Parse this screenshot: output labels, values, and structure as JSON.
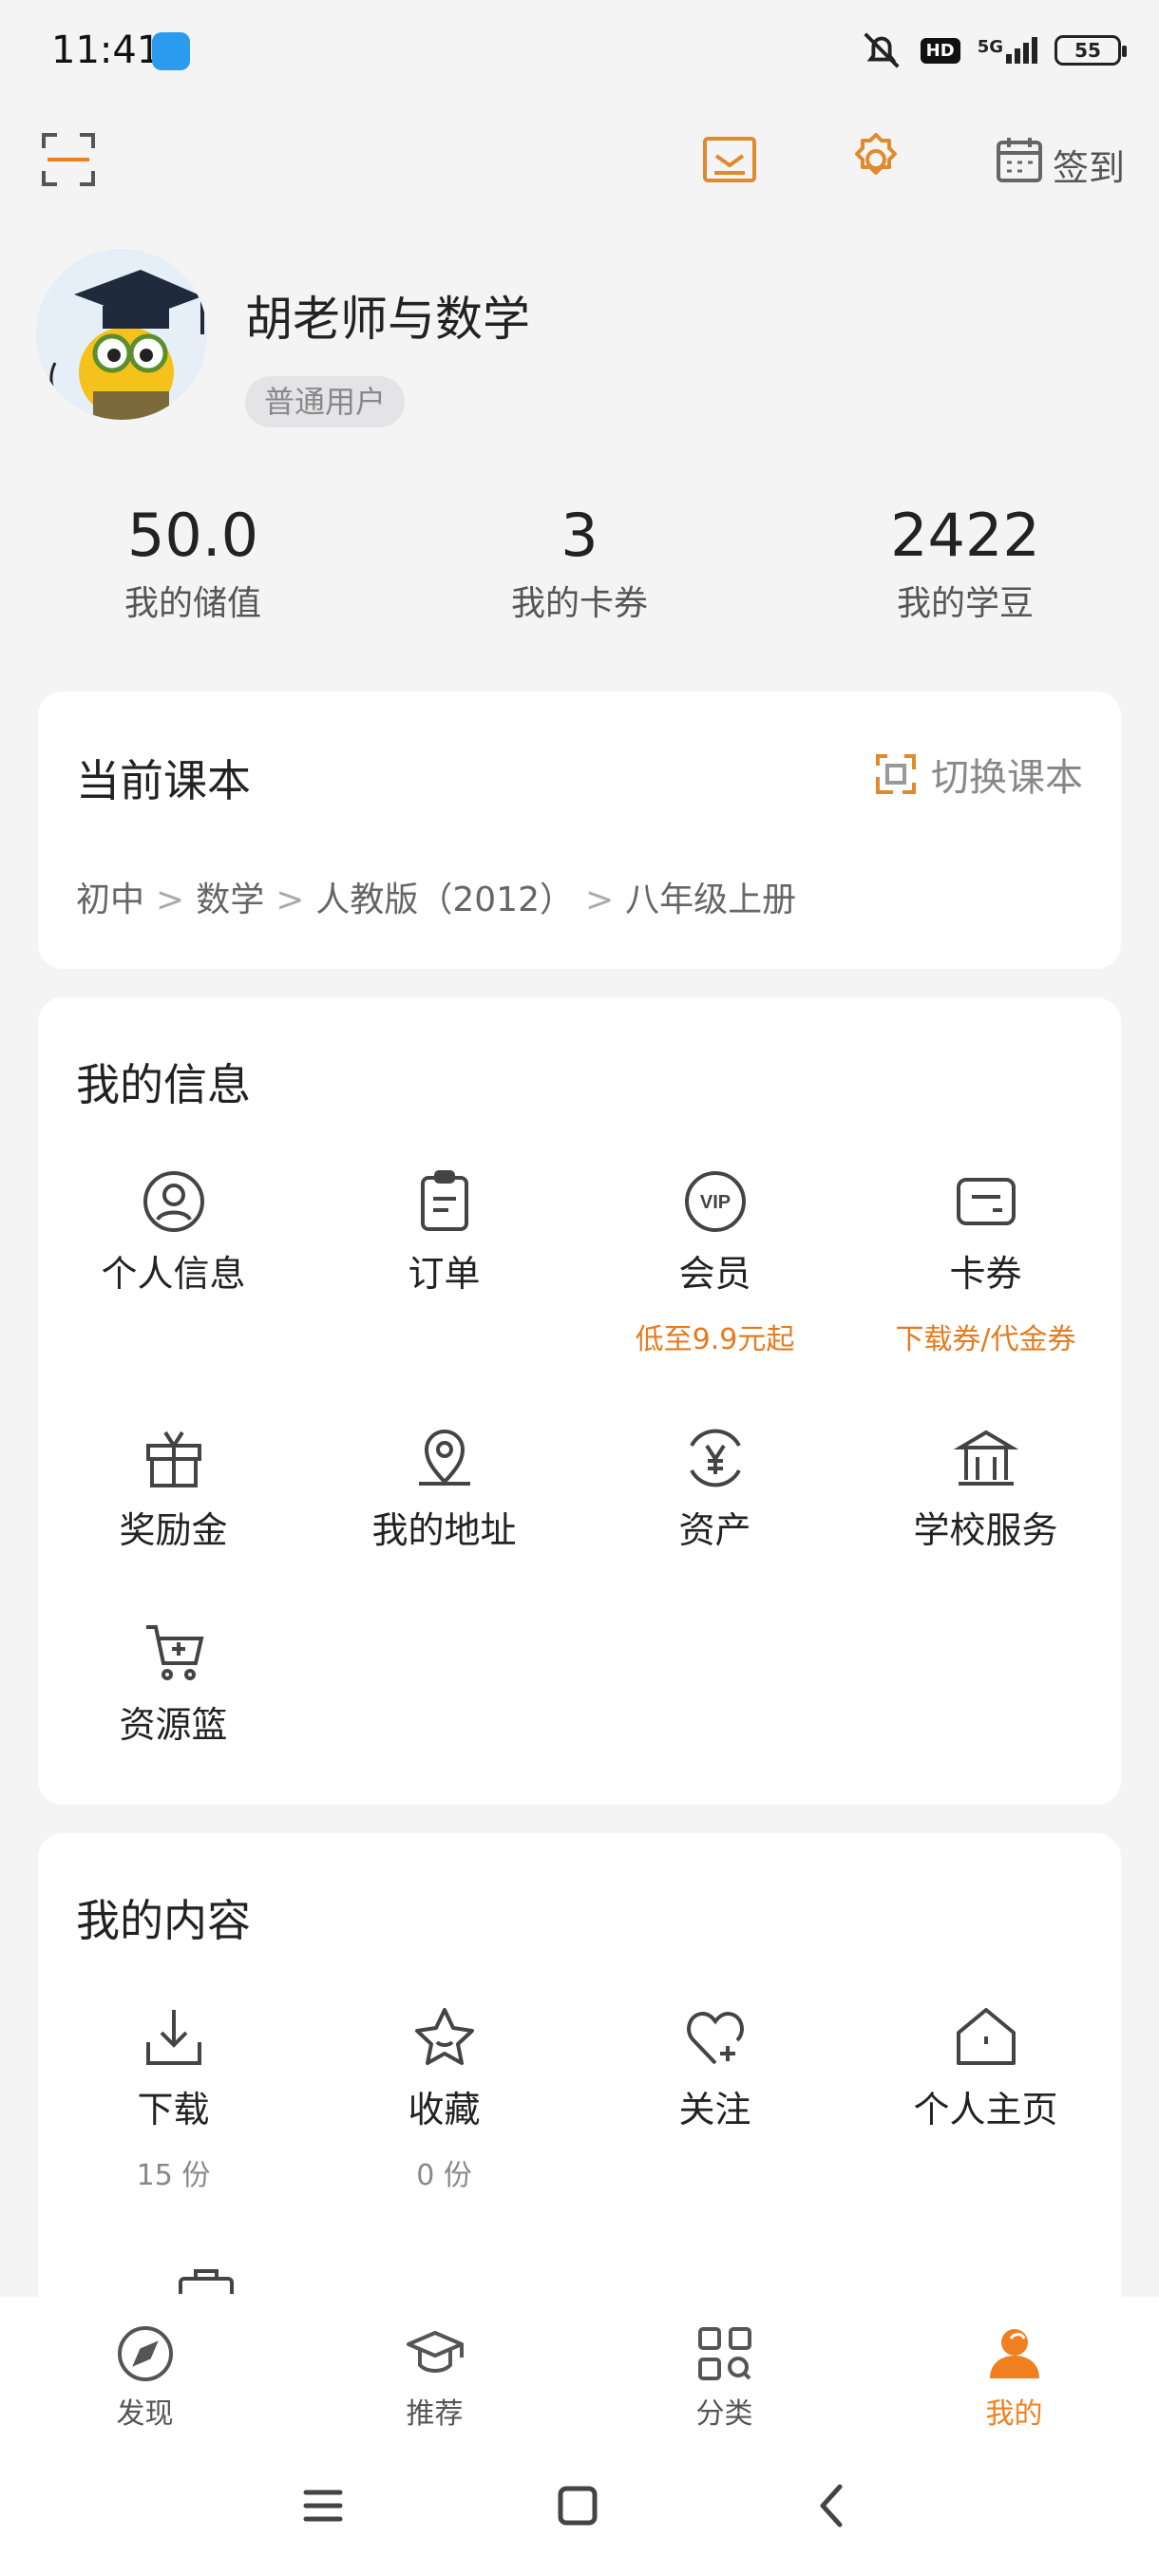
{
  "status_bar": {
    "time": "11:41",
    "network": "5G",
    "hd": "HD",
    "battery": "55"
  },
  "toolbar": {
    "checkin_label": "签到"
  },
  "profile": {
    "username": "胡老师与数学",
    "user_type": "普通用户"
  },
  "stats": [
    {
      "value": "50.0",
      "label": "我的储值"
    },
    {
      "value": "3",
      "label": "我的卡券"
    },
    {
      "value": "2422",
      "label": "我的学豆"
    }
  ],
  "textbook": {
    "title": "当前课本",
    "switch_label": "切换课本",
    "path": [
      "初中",
      "数学",
      "人教版（2012）",
      "八年级上册"
    ],
    "separator": ">"
  },
  "my_info": {
    "title": "我的信息",
    "items": [
      {
        "label": "个人信息",
        "icon": "user-icon"
      },
      {
        "label": "订单",
        "icon": "clipboard-icon"
      },
      {
        "label": "会员",
        "icon": "vip-icon",
        "sub": "低至9.9元起"
      },
      {
        "label": "卡券",
        "icon": "card-icon",
        "sub": "下载券/代金券"
      },
      {
        "label": "奖励金",
        "icon": "gift-icon"
      },
      {
        "label": "我的地址",
        "icon": "location-icon"
      },
      {
        "label": "资产",
        "icon": "yen-icon"
      },
      {
        "label": "学校服务",
        "icon": "school-icon"
      },
      {
        "label": "资源篮",
        "icon": "cart-icon"
      }
    ]
  },
  "my_content": {
    "title": "我的内容",
    "items": [
      {
        "label": "下载",
        "icon": "download-icon",
        "count": "15 份"
      },
      {
        "label": "收藏",
        "icon": "star-icon",
        "count": "0 份"
      },
      {
        "label": "关注",
        "icon": "heart-icon"
      },
      {
        "label": "个人主页",
        "icon": "home-icon"
      }
    ]
  },
  "bottom_nav": {
    "items": [
      {
        "label": "发现",
        "icon": "compass-icon"
      },
      {
        "label": "推荐",
        "icon": "graduation-cap-icon"
      },
      {
        "label": "分类",
        "icon": "category-icon"
      },
      {
        "label": "我的",
        "icon": "person-icon",
        "active": true
      }
    ]
  },
  "colors": {
    "accent": "#f07f1f",
    "sub_accent": "#e57b1e",
    "background": "#f4f4f5"
  }
}
